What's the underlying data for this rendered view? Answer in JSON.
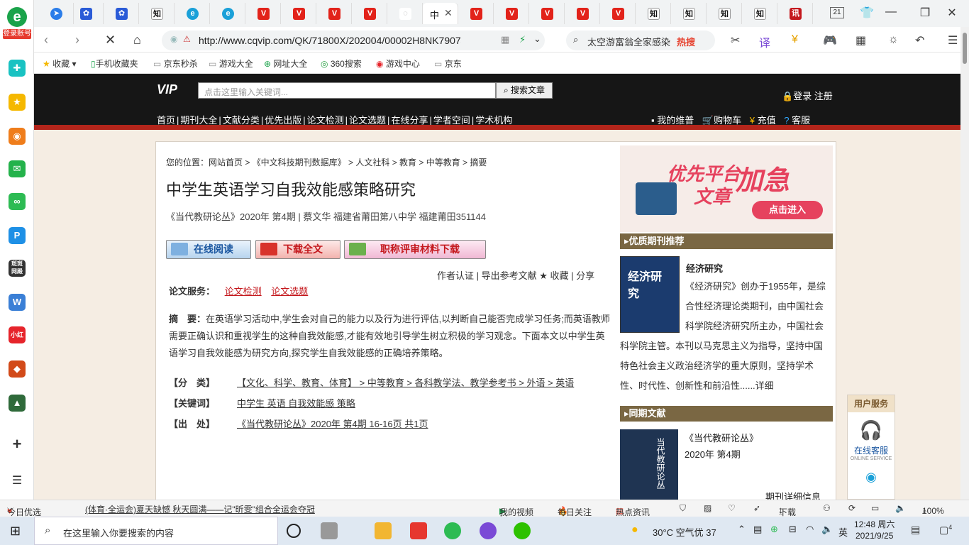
{
  "sidebar": {
    "account_label": "登录账号",
    "icons": [
      "plus-cross-icon",
      "star-icon",
      "weibo-icon",
      "mail-icon",
      "link-icon",
      "pay-icon",
      "game-icon",
      "doc-icon",
      "shop-icon",
      "chest-icon",
      "dice-icon"
    ]
  },
  "tabs": {
    "active_label": "中",
    "count": "21"
  },
  "address": {
    "url": "http://www.cqvip.com/QK/71800X/202004/00002H8NK7907JF",
    "search_text": "太空游富翁全家感染",
    "hot_label": "热搜"
  },
  "bookmarks": [
    "收藏",
    "手机收藏夹",
    "京东秒杀",
    "游戏大全",
    "网址大全",
    "360搜索",
    "游戏中心",
    "京东"
  ],
  "site": {
    "logo": "VIP",
    "search_placeholder": "点击这里输入关键词...",
    "search_button": "搜索文章",
    "login": "登录 注册",
    "nav": [
      "首页",
      "期刊大全",
      "文献分类",
      "优先出版",
      "论文检测",
      "论文选题",
      "在线分享",
      "学者空间",
      "学术机构"
    ],
    "right_nav": [
      "我的维普",
      "购物车",
      "充值",
      "客服"
    ]
  },
  "article": {
    "breadcrumb": "您的位置：网站首页 > 《中文科技期刊数据库》 > 人文社科 > 教育 > 中等教育 > 摘要",
    "title": "中学生英语学习自我效能感策略研究",
    "meta": "《当代教研论丛》2020年 第4期 | 蔡文华   福建省莆田第八中学 福建莆田351144",
    "btn_read": "在线阅读",
    "btn_download": "下载全文",
    "btn_title": "职称评审材料下载",
    "actions": "作者认证 | 导出参考文献 ★ 收藏 | 分享",
    "service_label": "论文服务：",
    "service_links": [
      "论文检测",
      "论文选题"
    ],
    "abstract_label": "摘　要：",
    "abstract": "在英语学习活动中,学生会对自己的能力以及行为进行评估,以判断自己能否完成学习任务;而英语教师需要正确认识和重视学生的这种自我效能感,才能有效地引导学生树立积极的学习观念。下面本文以中学生英语学习自我效能感为研究方向,探究学生自我效能感的正确培养策略。",
    "class_label": "【分　类】",
    "class_value": "【文化、科学、教育、体育】 > 中等教育 > 各科教学法、教学参考书 > 外语 > 英语",
    "keywords_label": "【关键词】",
    "keywords": "中学生 英语 自我效能感 策略",
    "source_label": "【出　处】",
    "source": "《当代教研论丛》2020年 第4期 16-16页 共1页"
  },
  "right": {
    "ad_text1": "优先平台",
    "ad_text2": "文章",
    "ad_text3": "加急",
    "ad_button": "点击进入",
    "sec1": "优质期刊推荐",
    "journal_name": "经济研究",
    "journal_desc": "《经济研究》创办于1955年，是综合性经济理论类期刊，由中国社会科学院经济研究所主办，中国社会科学院主管。本刊以马克思主义为指导，坚持中国特色社会主义政治经济学的重大原则，坚持学术性、时代性、创新性和前沿性......详细",
    "sec2": "同期文献",
    "same_title": "《当代教研论丛》",
    "same_issue": "2020年 第4期",
    "same_more": "期刊详细信息",
    "user_service": "用户服务",
    "online_service": "在线客服",
    "online_service_en": "ONLINE SERVICE"
  },
  "statusbar": {
    "left": "今日优选",
    "news": "(体育·全运会)夏天缺憾 秋天圆满——记\"昕雯\"组合全运会夺冠",
    "video": "我的视频",
    "daily": "每日关注",
    "hot": "热点资讯",
    "download": "下载",
    "zoom": "100%"
  },
  "taskbar": {
    "search_placeholder": "在这里输入你要搜索的内容",
    "weather": "30°C 空气优 37",
    "ime": "英",
    "time": "12:48 周六",
    "date": "2021/9/25",
    "notif": "4"
  }
}
